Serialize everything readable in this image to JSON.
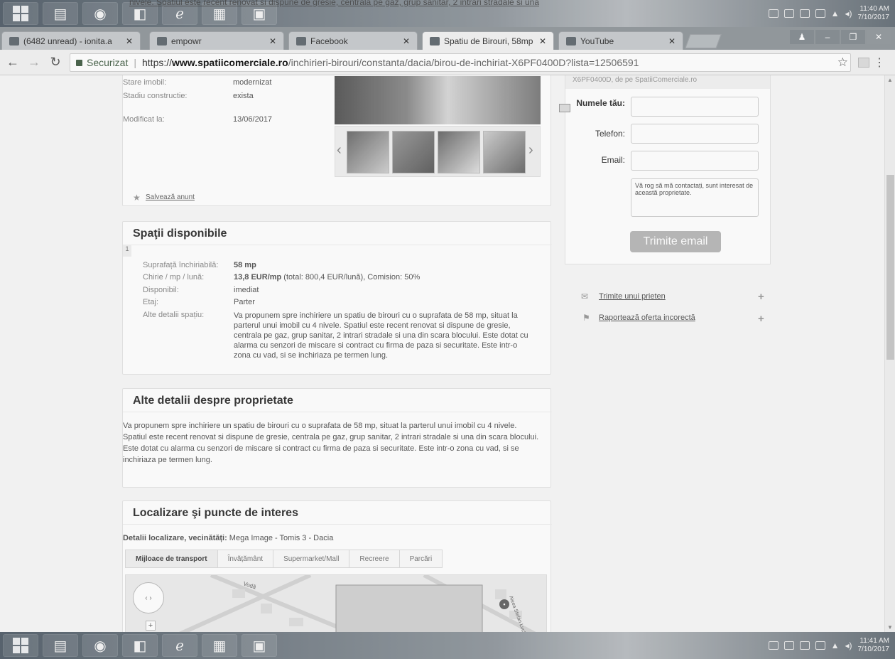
{
  "taskbar_top": {
    "ghost_text": "nivele. Spatiul este recent renovat si dispune de gresie, centrala pe gaz, grup sanitar, 2 intrari stradale si una",
    "clock_time": "11:40 AM",
    "clock_date": "7/10/2017"
  },
  "taskbar_bottom": {
    "clock_time": "11:41 AM",
    "clock_date": "7/10/2017"
  },
  "tabs": [
    {
      "label": "(6482 unread) - ionita.a"
    },
    {
      "label": "empowr"
    },
    {
      "label": "Facebook"
    },
    {
      "label": "Spatiu de Birouri, 58mp"
    },
    {
      "label": "YouTube"
    }
  ],
  "address": {
    "secure_label": "Securizat",
    "scheme": "https://",
    "host": "www.spatiicomerciale.ro",
    "path": "/inchirieri-birouri/constanta/dacia/birou-de-inchiriat-X6PF0400D?lista=12506591"
  },
  "details": {
    "stare_label": "Stare imobil:",
    "stare_value": "modernizat",
    "stadiu_label": "Stadiu constructie:",
    "stadiu_value": "exista",
    "modificat_label": "Modificat la:",
    "modificat_value": "13/06/2017",
    "save_link": "Salvează anunt"
  },
  "contact_form": {
    "head_text": "X6PF0400D, de pe SpatiiComerciale.ro",
    "name_label": "Numele tău:",
    "phone_label": "Telefon:",
    "email_label": "Email:",
    "message_text": "Vă rog să mă contactați, sunt interesat de această proprietate.",
    "submit_label": "Trimite email"
  },
  "side_links": {
    "friend": "Trimite unui prieten",
    "report": "Raportează oferta incorectă"
  },
  "spatii": {
    "title": "Spaţii disponibile",
    "index": "1",
    "suprafata_label": "Suprafață închiriabilă:",
    "suprafata_value": "58 mp",
    "chirie_label": "Chirie / mp / lună:",
    "chirie_value_bold": "13,8 EUR/mp",
    "chirie_value_rest": " (total: 800,4 EUR/lună), Comision: 50%",
    "disponibil_label": "Disponibil:",
    "disponibil_value": "imediat",
    "etaj_label": "Etaj:",
    "etaj_value": "Parter",
    "alte_label": "Alte detalii spațiu:",
    "alte_value": "Va propunem spre inchiriere un spatiu de birouri cu o suprafata de 58 mp, situat la parterul unui imobil cu 4 nivele. Spatiul este recent renovat si dispune de gresie, centrala pe gaz, grup sanitar, 2 intrari stradale si una din scara blocului. Este dotat cu alarma cu senzori de miscare si contract cu firma de paza si securitate. Este intr-o zona cu vad, si se inchiriaza pe termen lung."
  },
  "alte_detalii": {
    "title": "Alte detalii despre proprietate",
    "text": "Va propunem spre inchiriere un spatiu de birouri cu o suprafata de 58 mp, situat la parterul unui imobil cu 4 nivele. Spatiul este recent renovat si dispune de gresie, centrala pe gaz, grup sanitar, 2 intrari stradale si una din scara blocului. Este dotat cu alarma cu senzori de miscare si contract cu firma de paza si securitate. Este intr-o zona cu vad, si se inchiriaza pe termen lung."
  },
  "localizare": {
    "title": "Localizare şi puncte de interes",
    "vecinatati_label": "Detalii localizare, vecinătăți:",
    "vecinatati_value": " Mega Image - Tomis 3 - Dacia",
    "tabs": [
      "Mijloace de transport",
      "Învățământ",
      "Supermarket/Mall",
      "Recreere",
      "Parcări"
    ]
  },
  "map_labels": {
    "street_1": "Vodă",
    "street_2": "Aleea Stefan Luchian"
  }
}
